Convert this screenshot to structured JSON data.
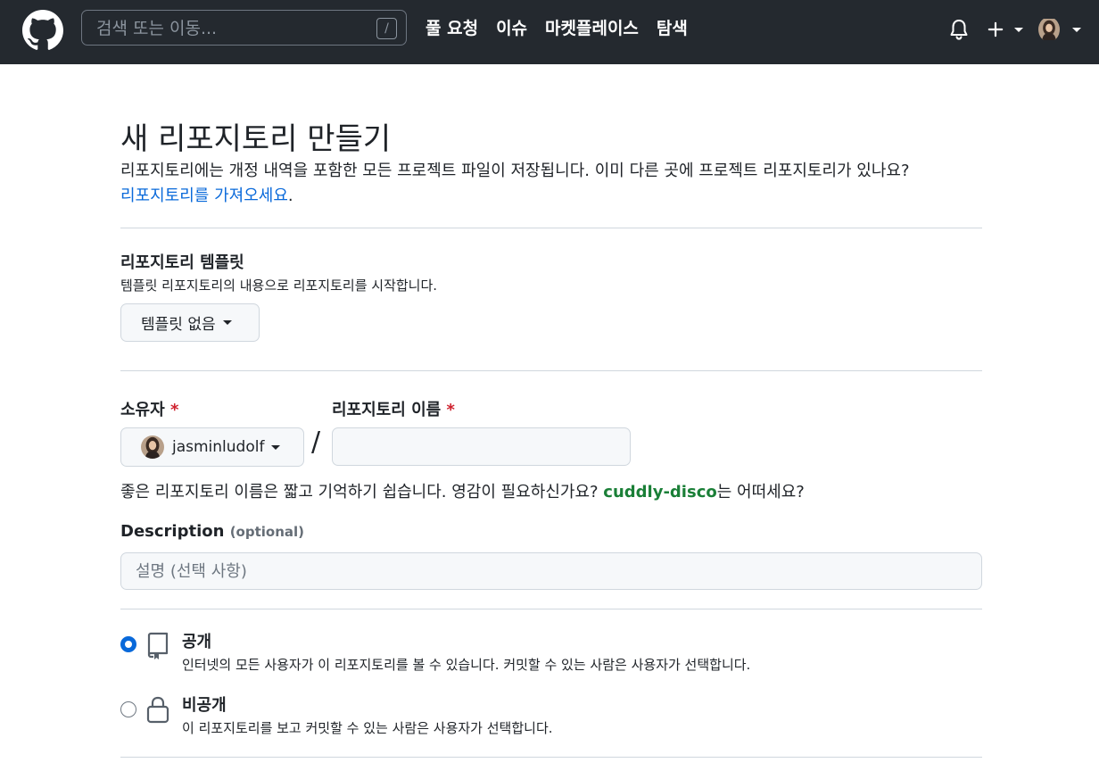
{
  "header": {
    "search_placeholder": "검색 또는 이동...",
    "search_shortcut": "/",
    "nav": [
      "풀 요청",
      "이슈",
      "마켓플레이스",
      "탐색"
    ],
    "plus_label": "+"
  },
  "page": {
    "title": "새 리포지토리 만들기",
    "intro": "리포지토리에는 개정 내역을 포함한 모든 프로젝트 파일이 저장됩니다. 이미 다른 곳에 프로젝트 리포지토리가 있나요?",
    "import_link": "리포지토리를 가져오세요",
    "import_suffix": "."
  },
  "template": {
    "label": "리포지토리 템플릿",
    "desc": "템플릿 리포지토리의 내용으로 리포지토리를 시작합니다.",
    "button": "템플릿 없음"
  },
  "owner": {
    "label": "소유자",
    "required_mark": "*",
    "value": "jasminludolf"
  },
  "repo_name": {
    "label": "리포지토리 이름",
    "required_mark": "*",
    "value": "",
    "separator": "/"
  },
  "hint": {
    "prefix": "좋은 리포지토리 이름은 짧고 기억하기 쉽습니다. 영감이 필요하신가요? ",
    "suggestion": "cuddly-disco",
    "suffix": "는 어떠세요?"
  },
  "description": {
    "label": "Description",
    "optional": "(optional)",
    "placeholder": "설명 (선택 사항)"
  },
  "visibility": [
    {
      "title": "공개",
      "desc": "인터넷의 모든 사용자가 이 리포지토리를 볼 수 있습니다. 커밋할 수 있는 사람은 사용자가 선택합니다.",
      "checked": true,
      "icon": "repo-icon"
    },
    {
      "title": "비공개",
      "desc": "이 리포지토리를 보고 커밋할 수 있는 사람은 사용자가 선택합니다.",
      "checked": false,
      "icon": "lock-icon"
    }
  ],
  "colors": {
    "header_bg": "#24292f",
    "link": "#0969da",
    "suggestion": "#1a7f37",
    "required": "#cf222e"
  }
}
